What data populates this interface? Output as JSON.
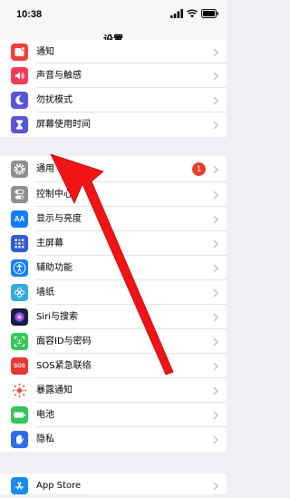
{
  "status_bar": {
    "time": "10:38"
  },
  "nav": {
    "title": "设置"
  },
  "group1": [
    {
      "label": "通知"
    },
    {
      "label": "声音与触感"
    },
    {
      "label": "勿扰模式"
    },
    {
      "label": "屏幕使用时间"
    }
  ],
  "group2": [
    {
      "label": "通用",
      "badge": "1"
    },
    {
      "label": "控制中心"
    },
    {
      "label": "显示与亮度",
      "icon_text": "AA"
    },
    {
      "label": "主屏幕"
    },
    {
      "label": "辅助功能"
    },
    {
      "label": "墙纸"
    },
    {
      "label": "Siri与搜索"
    },
    {
      "label": "面容ID与密码"
    },
    {
      "label": "SOS紧急联络",
      "icon_text": "SOS"
    },
    {
      "label": "暴露通知"
    },
    {
      "label": "电池"
    },
    {
      "label": "隐私"
    }
  ],
  "group3": [
    {
      "label": "App Store"
    }
  ],
  "colors": {
    "arrow": "#f01416",
    "notifications": "#f04038",
    "sounds": "#ef3d59",
    "dnd": "#5856d6",
    "screentime": "#5856d6",
    "general": "#8e8e93",
    "control": "#8e8e93",
    "display": "#147efb",
    "homescreen": "#2f5bd8",
    "accessibility": "#147efb",
    "wallpaper": "#35aadc",
    "siri": "#1c1c3a",
    "faceid": "#34c759",
    "sos": "#e53935",
    "exposure": "#ffffff",
    "battery": "#34c759",
    "privacy": "#2d6be8",
    "appstore": "#1a8cf0"
  }
}
